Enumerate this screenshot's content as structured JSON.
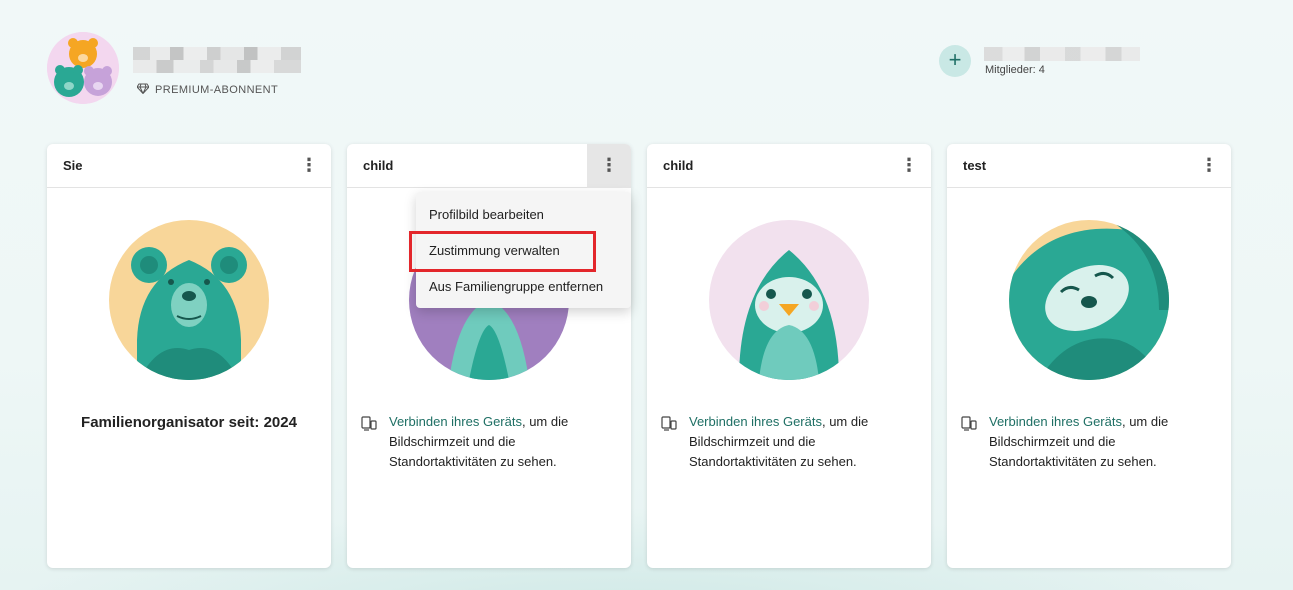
{
  "header": {
    "premium_label": "PREMIUM-ABONNENT",
    "members_label": "Mitglieder: 4"
  },
  "cards": [
    {
      "name": "Sie",
      "footer": "Familienorganisator seit: 2024"
    },
    {
      "name": "child",
      "link": "Verbinden ihres Geräts",
      "rest": ", um die Bildschirmzeit und die Standortaktivitäten zu sehen."
    },
    {
      "name": "child",
      "link": "Verbinden ihres Geräts",
      "rest": ", um die Bildschirmzeit und die Standortaktivitäten zu sehen."
    },
    {
      "name": "test",
      "link": "Verbinden ihres Geräts",
      "rest": ", um die Bildschirmzeit und die Standortaktivitäten zu sehen."
    }
  ],
  "menu": {
    "items": [
      "Profilbild bearbeiten",
      "Zustimmung verwalten",
      "Aus Familiengruppe entfernen"
    ]
  },
  "icons": {
    "more": "more-vertical-icon",
    "add": "plus-icon",
    "premium": "diamond-icon",
    "device": "devices-icon"
  },
  "colors": {
    "accent": "#1e6f64",
    "highlight": "#e3262b"
  }
}
